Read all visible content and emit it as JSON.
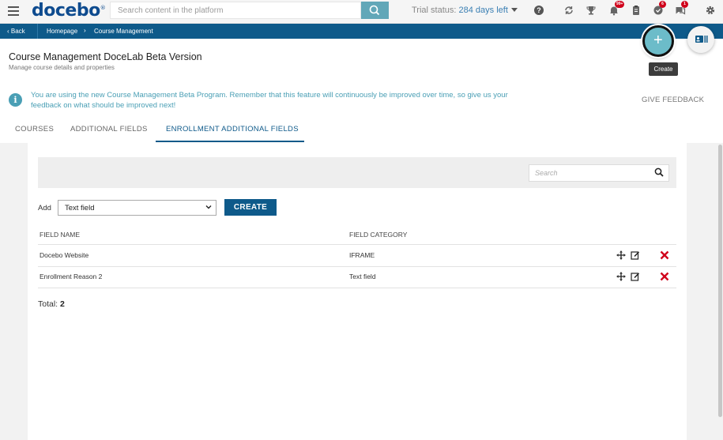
{
  "topbar": {
    "logo": "docebo",
    "logo_mark": "®",
    "search_placeholder": "Search content in the platform",
    "trial_label": "Trial status:",
    "trial_days": "284 days left",
    "badges": {
      "notifications": "99+",
      "tasks": "6",
      "messages": "1"
    }
  },
  "breadcrumb": {
    "back": "Back",
    "items": [
      "Homepage",
      "Course Management"
    ]
  },
  "fab": {
    "create_tooltip": "Create"
  },
  "header": {
    "title": "Course Management DoceLab Beta Version",
    "subtitle": "Manage course details and properties"
  },
  "info": {
    "text": "You are using the new Course Management Beta Program. Remember that this feature will continuously be improved over time, so give us your feedback on what should be improved next!",
    "feedback_link": "GIVE FEEDBACK"
  },
  "tabs": [
    {
      "label": "COURSES"
    },
    {
      "label": "ADDITIONAL FIELDS"
    },
    {
      "label": "ENROLLMENT ADDITIONAL FIELDS",
      "active": true
    }
  ],
  "filter": {
    "search_placeholder": "Search"
  },
  "add_form": {
    "label": "Add",
    "selected": "Text field",
    "button": "CREATE"
  },
  "table": {
    "columns": [
      "FIELD NAME",
      "FIELD CATEGORY"
    ],
    "rows": [
      {
        "name": "Docebo Website",
        "category": "IFRAME"
      },
      {
        "name": "Enrollment Reason 2",
        "category": "Text field"
      }
    ]
  },
  "footer": {
    "total_label": "Total:",
    "total_value": "2"
  },
  "colors": {
    "brand": "#0e5a8a",
    "accent": "#4a9fb5",
    "delete": "#d0021b"
  }
}
